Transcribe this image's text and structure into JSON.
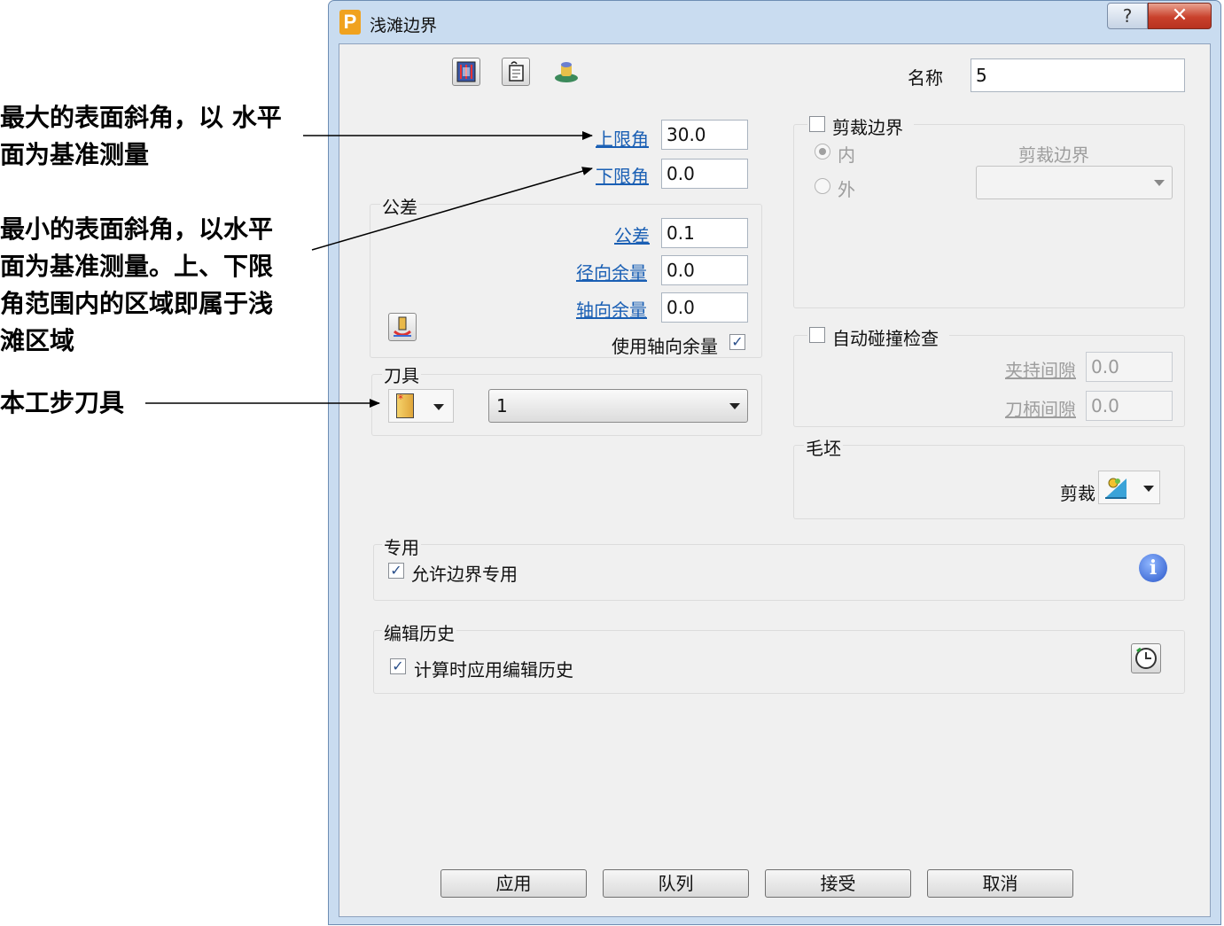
{
  "annotations": {
    "upper_note_line1": "最大的表面斜角，以 水平",
    "upper_note_line2": "面为基准测量",
    "lower_note_line1": "最小的表面斜角，以水平",
    "lower_note_line2": "面为基准测量。上、下限",
    "lower_note_line3": "角范围内的区域即属于浅",
    "lower_note_line4": "滩区域",
    "tool_note": "本工步刀具"
  },
  "window": {
    "title": "浅滩边界",
    "help_label": "?",
    "close_label": "✕"
  },
  "header": {
    "name_label": "名称",
    "name_value": "5"
  },
  "angles": {
    "upper_label": "上限角",
    "upper_value": "30.0",
    "lower_label": "下限角",
    "lower_value": "0.0"
  },
  "tolerance_group": {
    "title": "公差",
    "tolerance_label": "公差",
    "tolerance_value": "0.1",
    "radial_label": "径向余量",
    "radial_value": "0.0",
    "axial_label": "轴向余量",
    "axial_value": "0.0",
    "use_axial_label": "使用轴向余量",
    "use_axial_checked": "✓"
  },
  "tool_group": {
    "title": "刀具",
    "tool_value": "1"
  },
  "trim_group": {
    "title": "剪裁边界",
    "inside_label": "内",
    "outside_label": "外",
    "boundary_label": "剪裁边界",
    "boundary_value": ""
  },
  "collision_group": {
    "title": "自动碰撞检查",
    "holder_gap_label": "夹持间隙",
    "holder_gap_value": "0.0",
    "shank_gap_label": "刀柄间隙",
    "shank_gap_value": "0.0"
  },
  "stock_group": {
    "title": "毛坯",
    "trim_label": "剪裁"
  },
  "private_group": {
    "title": "专用",
    "allow_private_label": "允许边界专用",
    "allow_private_checked": "✓"
  },
  "history_group": {
    "title": "编辑历史",
    "apply_history_label": "计算时应用编辑历史",
    "apply_history_checked": "✓"
  },
  "buttons": {
    "apply": "应用",
    "queue": "队列",
    "accept": "接受",
    "cancel": "取消"
  }
}
